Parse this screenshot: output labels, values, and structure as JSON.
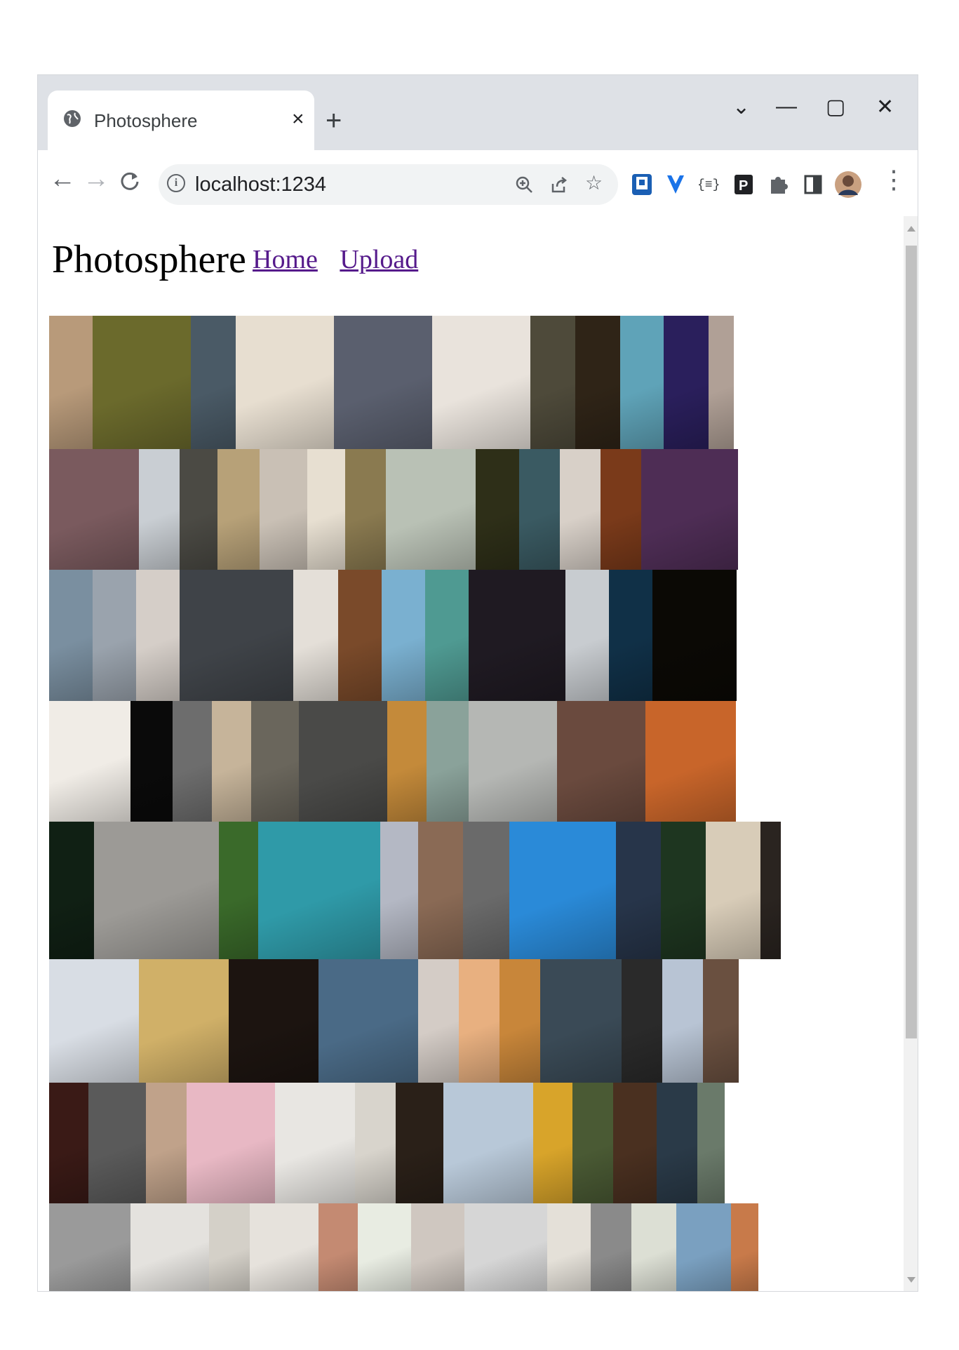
{
  "browser": {
    "tab_title": "Photosphere",
    "tab_close": "×",
    "new_tab": "+",
    "controls": {
      "tab_search": "⌄",
      "minimize": "—",
      "maximize": "▢",
      "close": "✕"
    },
    "url": "localhost:1234"
  },
  "page": {
    "title": "Photosphere",
    "nav": [
      "Home",
      "Upload"
    ]
  },
  "gallery": {
    "rows": [
      [
        "#b89a7a",
        "#6b6a2c",
        "#4a5a66",
        "#e7ded0",
        "#5a5f6e",
        "#e9e3dc",
        "#4e4a3a",
        "#2f2417",
        "#5fa3b8",
        "#2a1f5c",
        "#b0a096"
      ],
      [
        "#7a5a5e",
        "#c9ced3",
        "#4b4a44",
        "#b7a178",
        "#c9c0b5",
        "#e7dfd1",
        "#8a7a50",
        "#b9c1b5",
        "#2e2f18",
        "#3a5a62",
        "#d8d0c8",
        "#7a3a1a",
        "#4e2d55"
      ],
      [
        "#7a8fa0",
        "#9aa3ad",
        "#d5cec8",
        "#3f4348",
        "#e4dfd8",
        "#7a4a2a",
        "#7ab0d0",
        "#4f9a92",
        "#1f1a22",
        "#c8ccd0",
        "#103047",
        "#0b0905"
      ],
      [
        "#f0ece6",
        "#0a0a0a",
        "#6d6d6d",
        "#c6b49a",
        "#6a665c",
        "#4a4a48",
        "#c48a3a",
        "#8aa29a",
        "#b5b7b4",
        "#6a4a3e",
        "#c8652a"
      ],
      [
        "#102014",
        "#9c9a96",
        "#3a6a2a",
        "#2f9aa8",
        "#b4b8c4",
        "#8a6a55",
        "#6a6a6a",
        "#2a8ad8",
        "#27354a",
        "#1e3620",
        "#d8ccb8",
        "#2a2420"
      ],
      [
        "#d8dde4",
        "#d0b068",
        "#1c1410",
        "#4a6a86",
        "#d4ccc6",
        "#e8b080",
        "#c8863a",
        "#3a4a56",
        "#2a2a2a",
        "#b8c4d4",
        "#6a5040"
      ],
      [
        "#3a1a16",
        "#5a5a5a",
        "#c0a28a",
        "#e8b8c4",
        "#e8e6e2",
        "#d8d4cc",
        "#2a2018",
        "#b8c8d8",
        "#d8a42a",
        "#4a5a34",
        "#4a3020",
        "#2a3a48",
        "#6a7a6a"
      ],
      [
        "#9a9a9a",
        "#e4e2de",
        "#d4d0c8",
        "#e6e2dc",
        "#c48a72",
        "#e8ece2",
        "#cfc7c0",
        "#d6d6d6",
        "#e4e0d8",
        "#8a8a8a",
        "#dcdfd4",
        "#7aa0c0",
        "#c87a4a"
      ]
    ]
  }
}
